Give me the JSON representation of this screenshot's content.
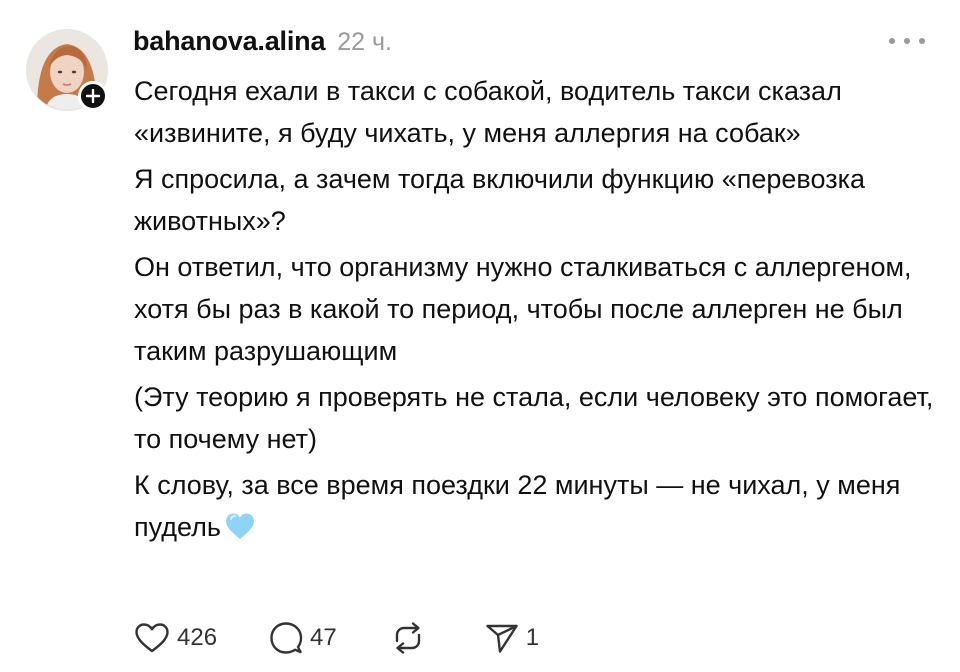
{
  "post": {
    "username": "bahanova.alina",
    "timestamp": "22 ч.",
    "paragraphs": [
      "Сегодня ехали в такси с собакой, водитель такси сказал «извините, я буду чихать, у меня аллергия на собак»",
      "Я спросила, а зачем тогда включили функцию «перевозка животных»?",
      "Он ответил, что организму нужно сталкиваться с аллергеном, хотя бы раз в какой то период, чтобы после аллерген не был таким разрушающим",
      "(Эту теорию я проверять не стала, если человеку это помогает, то почему нет)",
      "К слову, за все время поездки 22 минуты — не чихал, у меня пудель"
    ],
    "emoji": "light-blue-heart",
    "likes": "426",
    "replies": "47",
    "shares": "1"
  },
  "icons": {
    "more": "more-dots-icon",
    "like": "heart-icon",
    "reply": "comment-icon",
    "repost": "repost-icon",
    "share": "send-icon",
    "follow": "plus-icon"
  },
  "colors": {
    "text": "#111111",
    "muted": "#9a9a9a",
    "heart_emoji": "#8fd3f5"
  }
}
